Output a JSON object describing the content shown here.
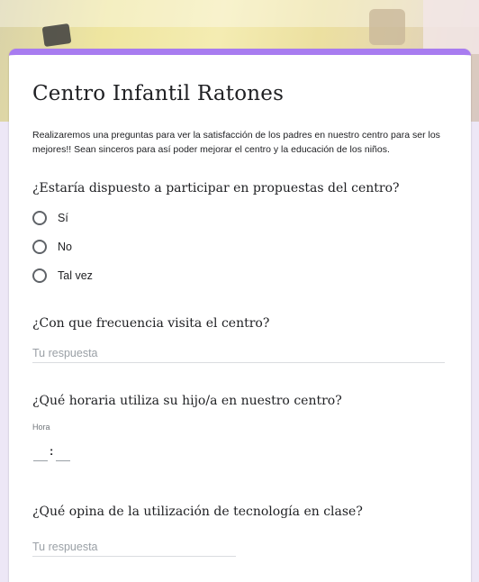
{
  "form": {
    "title": "Centro Infantil Ratones",
    "description": "Realizaremos una preguntas para ver la satisfacción de los padres en nuestro centro para ser los mejores!! Sean sinceros para así poder mejorar el centro y la educación de los niños.",
    "accent_color": "#a87cf0",
    "background_color": "#ede7f6"
  },
  "questions": {
    "q1": {
      "title": "¿Estaría dispuesto a participar en propuestas del centro?",
      "options": [
        "Sí",
        "No",
        "Tal vez"
      ]
    },
    "q2": {
      "title": "¿Con que frecuencia visita el centro?",
      "placeholder": "Tu respuesta"
    },
    "q3": {
      "title": "¿Qué horaria utiliza su hijo/a en nuestro centro?",
      "time_caption": "Hora",
      "separator": ":"
    },
    "q4": {
      "title": "¿Qué opina de la utilización de tecnología en clase?",
      "placeholder": "Tu respuesta"
    }
  }
}
